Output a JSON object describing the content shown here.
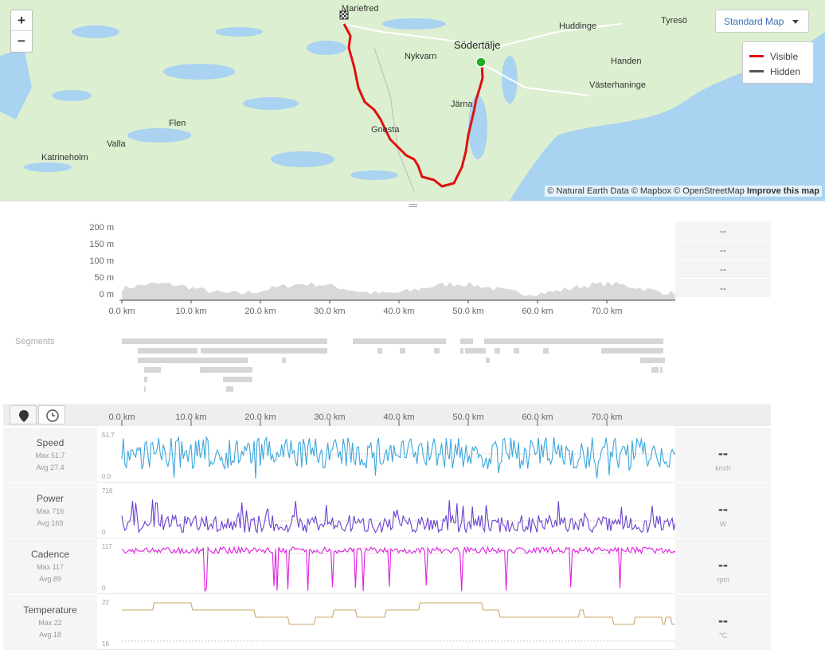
{
  "map": {
    "zoom_in": "+",
    "zoom_out": "−",
    "map_type_label": "Standard Map",
    "legend": {
      "visible": "Visible",
      "hidden": "Hidden"
    },
    "legend_colors": {
      "visible": "#e01010",
      "hidden": "#555555"
    },
    "route_color": "#e01010",
    "start_marker_color": "#1fb01f",
    "attribution": "© Natural Earth Data © Mapbox © OpenStreetMap",
    "improve_link": "Improve this map",
    "places": {
      "mariefred": "Mariefred",
      "sodertalje": "Södertälje",
      "huddinge": "Huddinge",
      "tyreso": "Tyresö",
      "nykvarn": "Nykvarn",
      "handen": "Handen",
      "vasterhaninge": "Västerhaninge",
      "jarna": "Järna",
      "flen": "Flen",
      "gnesta": "Gnesta",
      "valla": "Valla",
      "katrineholm": "Katrineholm"
    }
  },
  "elevation": {
    "y_ticks": [
      "200 m",
      "150 m",
      "100 m",
      "50 m",
      "0 m"
    ],
    "x_ticks": [
      "0.0 km",
      "10.0 km",
      "20.0 km",
      "30.0 km",
      "40.0 km",
      "50.0 km",
      "60.0 km",
      "70.0 km"
    ],
    "stats": [
      "--",
      "--",
      "--",
      "--"
    ]
  },
  "segments": {
    "label": "Segments"
  },
  "toolbar": {
    "distance_icon": "map-pin-icon",
    "time_icon": "clock-icon",
    "x_ticks": [
      "0.0 km",
      "10.0 km",
      "20.0 km",
      "30.0 km",
      "40.0 km",
      "50.0 km",
      "60.0 km",
      "70.0 km"
    ]
  },
  "streams": [
    {
      "name": "Speed",
      "max": "Max 51.7",
      "avg": "Avg 27.4",
      "ymax": "51.7",
      "ymin": "0.0",
      "value": "--",
      "unit": "km/h",
      "color": "#3aa6dc"
    },
    {
      "name": "Power",
      "max": "Max 716",
      "avg": "Avg 169",
      "ymax": "716",
      "ymin": "0",
      "value": "--",
      "unit": "W",
      "color": "#6b3fcf"
    },
    {
      "name": "Cadence",
      "max": "Max 117",
      "avg": "Avg 89",
      "ymax": "117",
      "ymin": "0",
      "value": "--",
      "unit": "rpm",
      "color": "#e020e0"
    },
    {
      "name": "Temperature",
      "max": "Max 22",
      "avg": "Avg 18",
      "ymax": "22",
      "ymin": "16",
      "value": "--",
      "unit": "°C",
      "color": "#c8a96a"
    }
  ]
}
